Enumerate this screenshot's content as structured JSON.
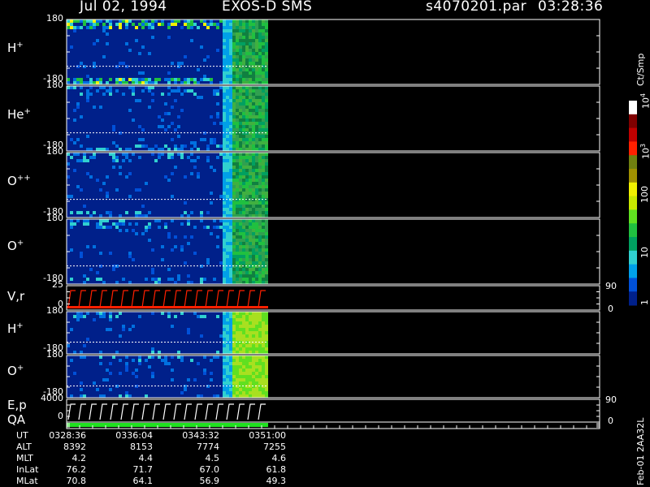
{
  "header": {
    "date": "Jul 02, 1994",
    "instrument": "EXOS-D SMS",
    "file": "s4070201.par",
    "time": "03:28:36"
  },
  "colorbar": {
    "unit": "Ct/Smp",
    "tick_labels": [
      "1",
      "10",
      "100",
      "10",
      "10"
    ],
    "exponents": [
      "",
      "",
      "",
      "3",
      "4"
    ],
    "colors": [
      "#00208a",
      "#0050d8",
      "#00a0e8",
      "#30d0d0",
      "#00a060",
      "#20c040",
      "#60e020",
      "#c8e800",
      "#f0f000",
      "#a09000",
      "#708010",
      "#ff2000",
      "#c00000",
      "#800000",
      "#ffffff"
    ]
  },
  "panels": [
    {
      "name": "H",
      "sup": "+",
      "top": "180",
      "bottom": "-180",
      "type": "spectrogram"
    },
    {
      "name": "He",
      "sup": "+",
      "top": "180",
      "bottom": "-180",
      "type": "spectrogram"
    },
    {
      "name": "O",
      "sup": "++",
      "top": "180",
      "bottom": "-180",
      "type": "spectrogram"
    },
    {
      "name": "O",
      "sup": "+",
      "top": "180",
      "bottom": "-180",
      "type": "spectrogram"
    },
    {
      "name": "V,r",
      "sup": "",
      "top": "25",
      "bottom": "0",
      "right_top": "90",
      "right_bottom": "0",
      "type": "sweep"
    },
    {
      "name": "H",
      "sup": "+",
      "top": "180",
      "bottom": "-180",
      "type": "spectrogram"
    },
    {
      "name": "O",
      "sup": "+",
      "top": "180",
      "bottom": "-180",
      "type": "spectrogram"
    },
    {
      "name": "E,p",
      "sup": "",
      "top": "4000",
      "bottom": "0",
      "right_top": "90",
      "right_bottom": "0",
      "type": "sweep"
    },
    {
      "name": "QA",
      "sup": "",
      "type": "qa"
    }
  ],
  "footer": {
    "rows": [
      {
        "label": "UT",
        "values": [
          "0328:36",
          "0336:04",
          "0343:32",
          "0351:00"
        ]
      },
      {
        "label": "ALT",
        "values": [
          "8392",
          "8153",
          "7774",
          "7255"
        ]
      },
      {
        "label": "MLT",
        "values": [
          "4.2",
          "4.4",
          "4.5",
          "4.6"
        ]
      },
      {
        "label": "InLat",
        "values": [
          "76.2",
          "71.7",
          "67.0",
          "61.8"
        ]
      },
      {
        "label": "MLat",
        "values": [
          "70.8",
          "64.1",
          "56.9",
          "49.3"
        ]
      }
    ],
    "stamp": "Feb-01 2AA32L"
  },
  "chart_data": {
    "type": "heatmap",
    "title": "Jul 02, 1994 EXOS-D SMS",
    "x_ticks": [
      "0328:36",
      "0336:04",
      "0343:32",
      "0351:00"
    ],
    "ylim_panels": [
      [
        -180,
        180
      ],
      [
        -180,
        180
      ],
      [
        -180,
        180
      ],
      [
        -180,
        180
      ],
      [
        0,
        25
      ],
      [
        -180,
        180
      ],
      [
        -180,
        180
      ],
      [
        0,
        4000
      ]
    ],
    "colorbar_range": [
      1,
      10000
    ],
    "colorbar_scale": "log",
    "legend_placement": "right"
  }
}
